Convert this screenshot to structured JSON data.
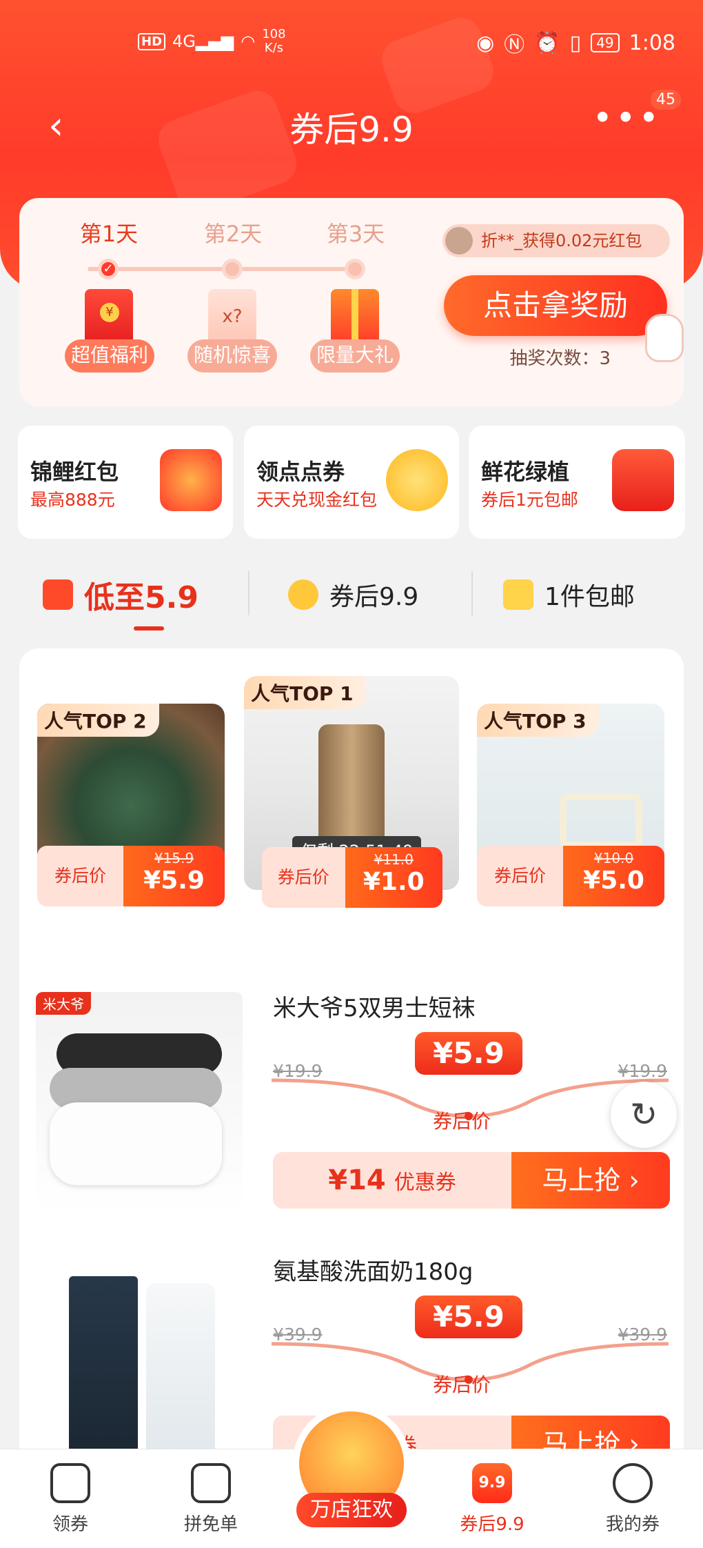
{
  "status_bar": {
    "hd": "HD",
    "signal": "4G",
    "speed_value": "108",
    "speed_unit": "K/s",
    "battery": "49",
    "time": "1:08"
  },
  "header": {
    "title": "券后9.9",
    "more_badge": "45"
  },
  "checkin": {
    "days": [
      "第1天",
      "第2天",
      "第3天"
    ],
    "rewards": [
      "超值福利",
      "随机惊喜",
      "限量大礼"
    ],
    "winner_text": "折**_获得0.02元红包",
    "claim_button": "点击拿奖励",
    "draw_count_label": "抽奖次数：3",
    "mystery_mark": "x?"
  },
  "promos": [
    {
      "title": "锦鲤红包",
      "subtitle": "最高888元"
    },
    {
      "title": "领点点券",
      "subtitle": "天天兑现金红包"
    },
    {
      "title": "鲜花绿植",
      "subtitle": "券后1元包邮"
    }
  ],
  "tabs": [
    {
      "label": "低至5.9",
      "active": true
    },
    {
      "label": "券后9.9",
      "active": false
    },
    {
      "label": "1件包邮",
      "active": false
    }
  ],
  "top_items": [
    {
      "badge": "人气TOP 2",
      "price_label": "券后价",
      "orig": "¥15.9",
      "now": "¥5.9"
    },
    {
      "badge": "人气TOP 1",
      "price_label": "券后价",
      "orig": "¥11.0",
      "now": "¥1.0",
      "countdown": "仅剩 22:51:49"
    },
    {
      "badge": "人气TOP 3",
      "price_label": "券后价",
      "orig": "¥10.0",
      "now": "¥5.0"
    }
  ],
  "products": [
    {
      "title": "米大爷5双男士短袜",
      "price": "¥5.9",
      "orig": "¥19.9",
      "after_label": "券后价",
      "coupon_amount": "¥14",
      "coupon_unit": "优惠券",
      "button": "马上抢 ›",
      "tag": "米大爷"
    },
    {
      "title": "氨基酸洗面奶180g",
      "price": "¥5.9",
      "orig": "¥39.9",
      "after_label": "券后价",
      "coupon_amount": "",
      "coupon_unit": "惠券",
      "button": "马上抢 ›"
    }
  ],
  "bottom_nav": {
    "items": [
      "领券",
      "拼免单",
      "券后9.9",
      "我的券"
    ],
    "center_label": "万店狂欢",
    "active_icon_text": "9.9"
  }
}
